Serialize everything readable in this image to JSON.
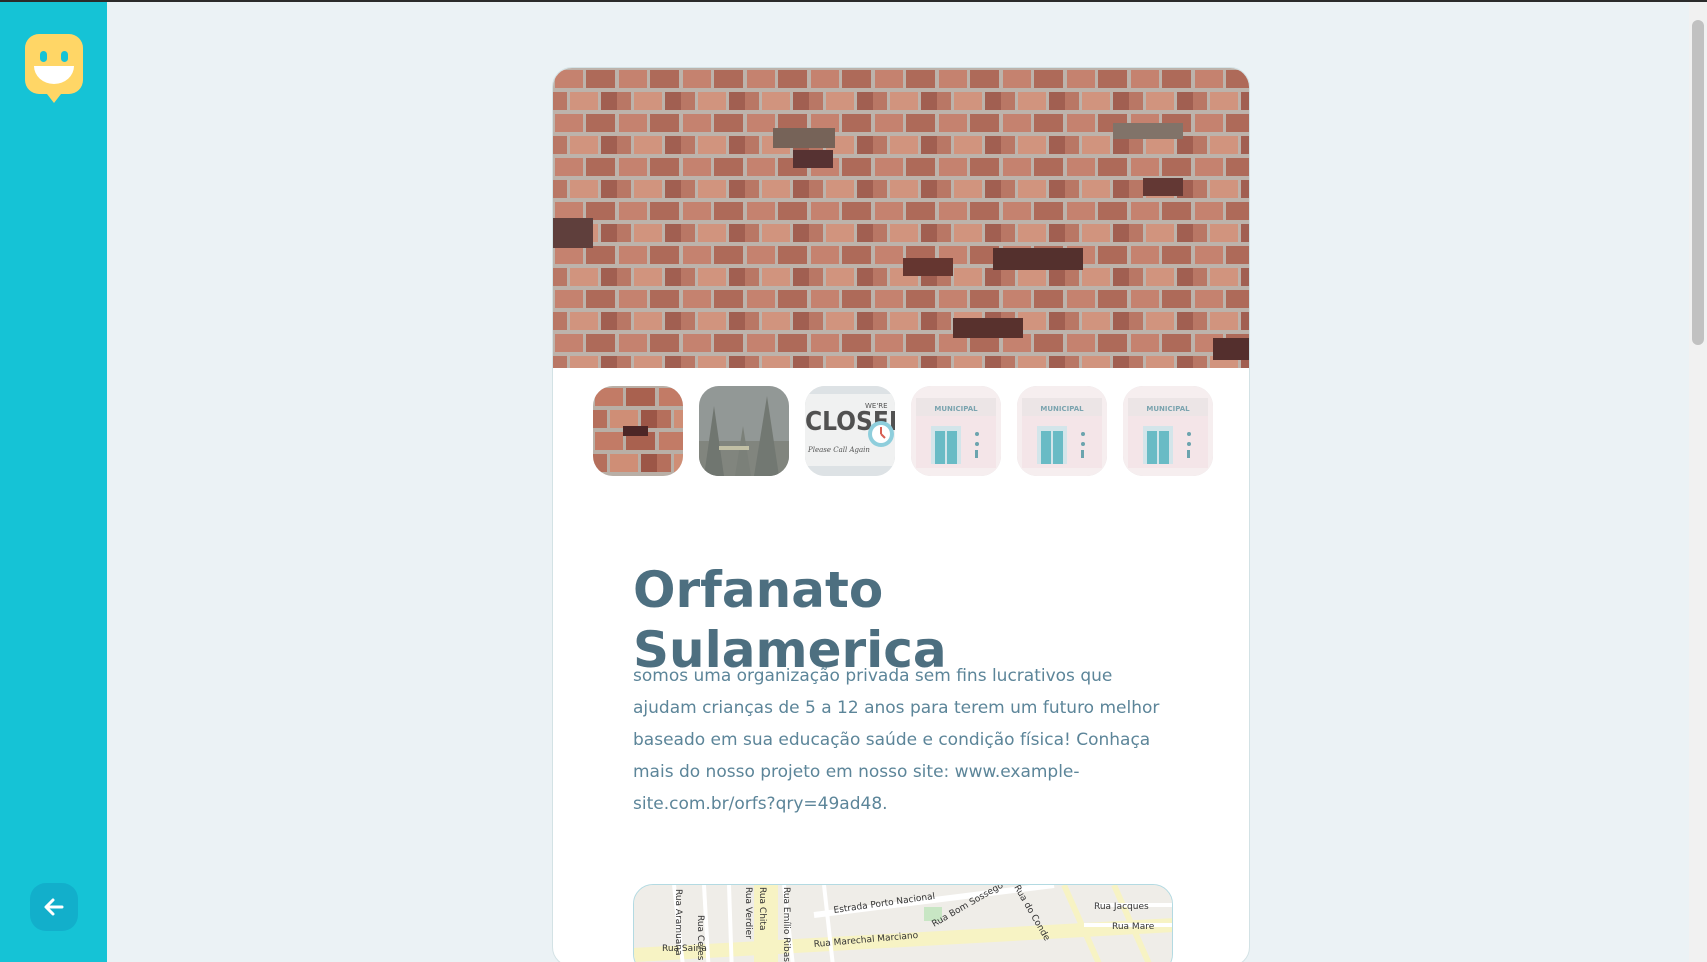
{
  "sidebar": {
    "logo_icon": "smiley-marker-icon",
    "back_icon": "arrow-left-icon",
    "background_color": "#15c3d6",
    "logo_color": "#ffd666"
  },
  "orphanage": {
    "name": "Orfanato Sulamerica",
    "about": "somos uma organização privada sem fins lucrativos que ajudam crianças de 5 a 12 anos para terem um futuro melhor baseado em sua educação saúde e condição física! Conhaça mais do nosso projeto em nosso site: www.example-site.com.br/orfs?qry=49ad48.",
    "title_color": "#4d6f80",
    "text_color": "#5c8599"
  },
  "gallery": {
    "thumbnails": [
      {
        "subject": "brick wall",
        "active": true
      },
      {
        "subject": "forest",
        "active": false
      },
      {
        "subject": "closed sign",
        "active": false
      },
      {
        "subject": "municipal building",
        "active": false,
        "sign_text": "MUNICIPAL"
      },
      {
        "subject": "municipal building",
        "active": false,
        "sign_text": "MUNICIPAL"
      },
      {
        "subject": "municipal building",
        "active": false,
        "sign_text": "MUNICIPAL"
      }
    ],
    "closed_sign": {
      "word": "CLOSED",
      "top_text": "WE'RE",
      "script_text": "Please Call Again"
    }
  },
  "map": {
    "streets": [
      "Estrada Porto Nacional",
      "Rua Bom Sossego",
      "Rua Marechal Marciano",
      "Rua Jacques",
      "Rua Saina",
      "Rua Aramuana",
      "Rua Ceres",
      "Rua Verdier",
      "Rua Emílio Ribas",
      "Rua do Conde",
      "Rua Mare",
      "Rua Chita"
    ]
  }
}
